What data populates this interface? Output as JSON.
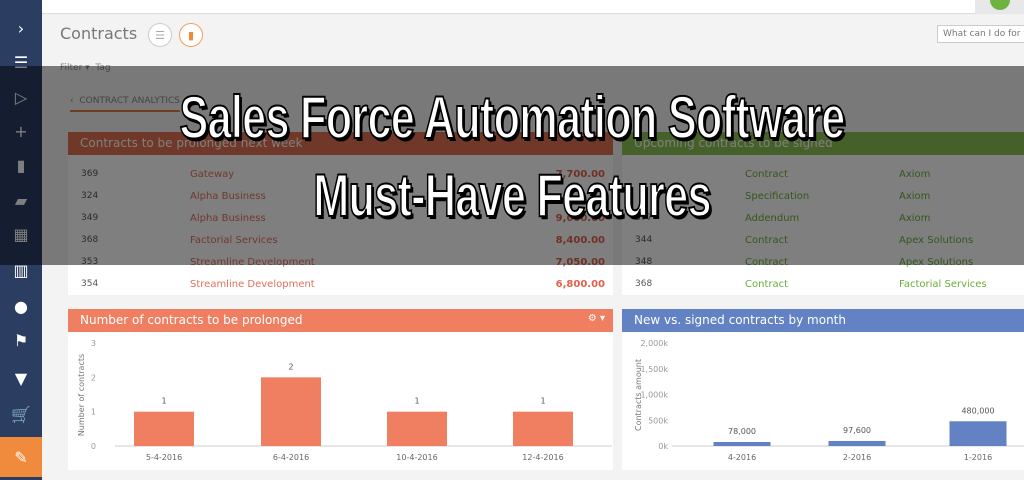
{
  "sidebar": {
    "items": [
      "chevron-right-icon",
      "menu-icon",
      "play-icon",
      "plus-icon",
      "bar-chart-icon",
      "chat-icon",
      "buildings-icon",
      "building-icon",
      "user-icon",
      "flag-icon",
      "funnel-icon",
      "cart-icon",
      "contract-icon"
    ],
    "glyphs": [
      "›",
      "☰",
      "▷",
      "+",
      "▮",
      "▰",
      "▦",
      "▥",
      "●",
      "⚑",
      "▼",
      "🛒",
      "✎"
    ],
    "active_index": 12,
    "colors": {
      "sidebar": "#2b3d60",
      "active": "#f08a3c"
    }
  },
  "header": {
    "title": "Contracts",
    "search_placeholder": "What can I do for you?",
    "filter_label": "Filter ▾",
    "tag_label": "Tag",
    "tab_label": "CONTRACT ANALYTICS"
  },
  "table_prolonged": {
    "title": "Contracts to be prolonged next week",
    "color": "#e07050",
    "rows": [
      {
        "id": "369",
        "account": "Gateway",
        "amount": "7,700.00"
      },
      {
        "id": "324",
        "account": "Alpha Business",
        "amount": ""
      },
      {
        "id": "349",
        "account": "Alpha Business",
        "amount": "9,600.00"
      },
      {
        "id": "368",
        "account": "Factorial Services",
        "amount": "8,400.00"
      },
      {
        "id": "353",
        "account": "Streamline Development",
        "amount": "7,050.00"
      },
      {
        "id": "354",
        "account": "Streamline Development",
        "amount": "6,800.00"
      }
    ]
  },
  "table_upcoming": {
    "title": "Upcoming contracts to be signed",
    "color": "#8cc152",
    "rows": [
      {
        "id": "",
        "type": "Contract",
        "account": "Axiom"
      },
      {
        "id": "",
        "type": "Specification",
        "account": "Axiom"
      },
      {
        "id": "377",
        "type": "Addendum",
        "account": "Axiom"
      },
      {
        "id": "344",
        "type": "Contract",
        "account": "Apex Solutions"
      },
      {
        "id": "348",
        "type": "Contract",
        "account": "Apex Solutions"
      },
      {
        "id": "368",
        "type": "Contract",
        "account": "Factorial Services"
      }
    ]
  },
  "overlay": {
    "line1": "Sales Force Automation Software",
    "line2": "Must-Have Features"
  },
  "chart_data": [
    {
      "type": "bar",
      "title": "Number of contracts to be prolonged",
      "ylabel": "Number of contracts",
      "xlabel": "",
      "categories": [
        "5-4-2016",
        "6-4-2016",
        "10-4-2016",
        "12-4-2016"
      ],
      "values": [
        1,
        2,
        1,
        1
      ],
      "data_labels": [
        "1",
        "2",
        "1",
        "1"
      ],
      "ylim": [
        0,
        3
      ],
      "yticks": [
        "0",
        "1",
        "2",
        "3"
      ],
      "color": "#f07f62",
      "grid": false
    },
    {
      "type": "bar",
      "title": "New vs. signed contracts by month",
      "ylabel": "Contracts amount",
      "xlabel": "",
      "categories": [
        "4-2016",
        "2-2016",
        "1-2016"
      ],
      "values": [
        78000,
        97600,
        480000
      ],
      "data_labels": [
        "78,000",
        "97,600",
        "480,000"
      ],
      "ylim": [
        0,
        2000000
      ],
      "yticks": [
        "0k",
        "500k",
        "1,000k",
        "1,500k",
        "2,000k"
      ],
      "color": "#6382c4",
      "grid": false
    }
  ]
}
